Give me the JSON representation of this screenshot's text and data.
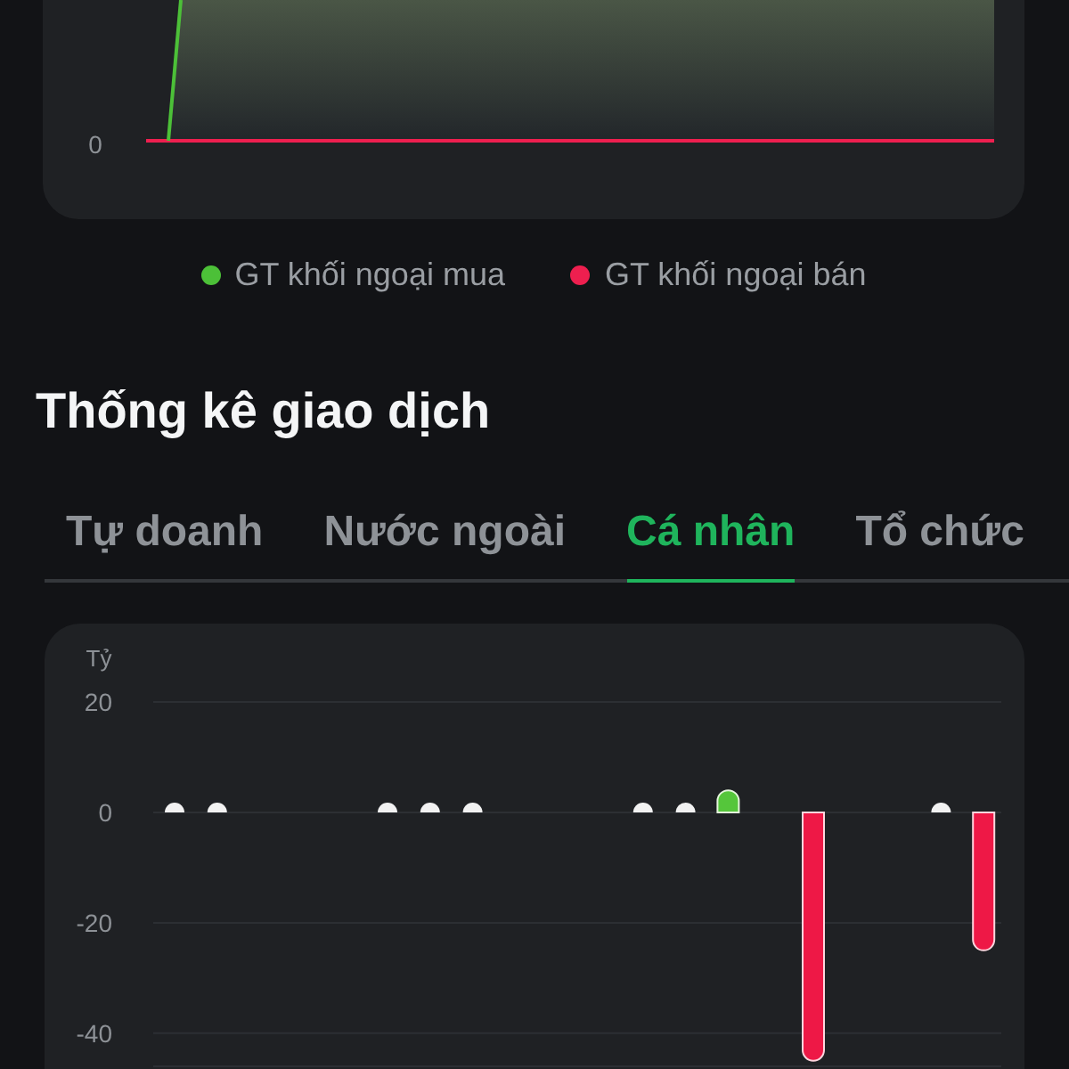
{
  "top_chart": {
    "y_tick": "0",
    "legend": [
      {
        "label": "GT khối ngoại mua",
        "color": "#4cc038"
      },
      {
        "label": "GT khối ngoại bán",
        "color": "#ee1f4f"
      }
    ]
  },
  "statistics": {
    "title": "Thống kê giao dịch",
    "tabs": [
      {
        "label": "Tự doanh",
        "selected": false
      },
      {
        "label": "Nước ngoài",
        "selected": false
      },
      {
        "label": "Cá nhân",
        "selected": true
      },
      {
        "label": "Tổ chức",
        "selected": false
      }
    ],
    "chart_data": {
      "type": "bar",
      "ylabel": "Tỷ",
      "ylim": [
        -46,
        20
      ],
      "yticks": [
        20,
        0,
        -20,
        -40
      ],
      "grid": true,
      "values": [
        0,
        0,
        null,
        null,
        null,
        0,
        0,
        0,
        null,
        null,
        null,
        0,
        0,
        4,
        null,
        -45,
        null,
        null,
        0,
        -25
      ]
    }
  }
}
